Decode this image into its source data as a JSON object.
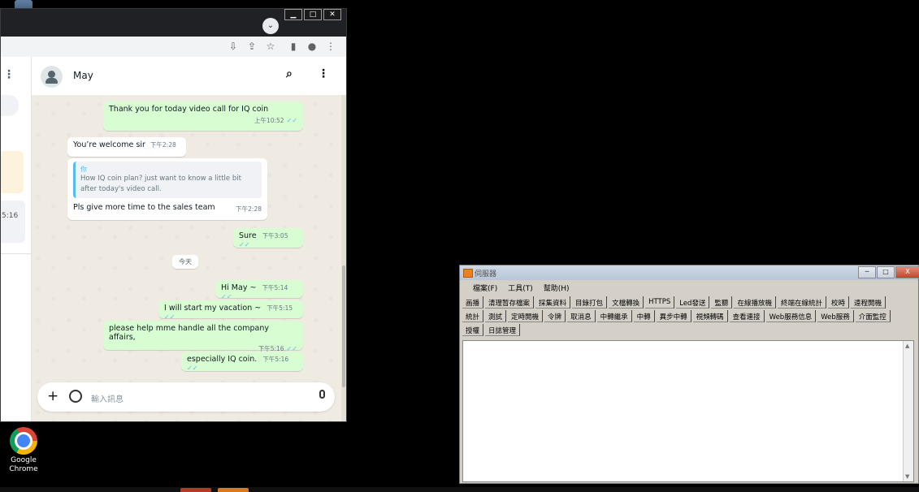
{
  "desktop": {
    "top_icon_label": "",
    "chrome_icon_label_line1": "Google",
    "chrome_icon_label_line2": "Chrome"
  },
  "chrome_window": {
    "caption_buttons": [
      "▁",
      "□",
      "✕"
    ],
    "tab_search_icon": "chevron-down-icon",
    "toolbar_icons": [
      "install-icon",
      "share-icon",
      "star-icon",
      "sidepanel-icon",
      "profile-icon",
      "menu-icon"
    ]
  },
  "whatsapp": {
    "sidebar_time": "5:16",
    "contact_name": "May",
    "messages": [
      {
        "dir": "out",
        "text": "Thank you for today video call for IQ coin",
        "time": "上午10:52",
        "ticks": "✓✓"
      },
      {
        "dir": "in",
        "text": "You’re welcome sir",
        "time": "下午2:28"
      },
      {
        "dir": "in",
        "reply_author": "你",
        "reply_text": "How IQ coin plan? just want to know a little bit after today's video call.",
        "text": "Pls give more time to the sales team",
        "time": "下午2:28"
      },
      {
        "dir": "out",
        "text": "Sure",
        "time": "下午3:05",
        "ticks": "✓✓"
      },
      {
        "dir": "out",
        "text": "Hi May ~",
        "time": "下午5:14",
        "ticks": "✓✓"
      },
      {
        "dir": "out",
        "text": "I will start my vacation ~",
        "time": "下午5:15",
        "ticks": "✓✓"
      },
      {
        "dir": "out",
        "text": "please help mme handle all the company affairs,",
        "time": "下午5:16",
        "ticks": "✓✓"
      },
      {
        "dir": "out",
        "text": "especially IQ coin.",
        "time": "下午5:16",
        "ticks": "✓✓"
      }
    ],
    "date_divider": "今天",
    "composer_placeholder": "輸入訊息"
  },
  "tool_window": {
    "title": "伺服器",
    "caption_buttons": [
      "─",
      "□",
      "X"
    ],
    "menu": [
      "檔案(F)",
      "工具(T)",
      "幫助(H)"
    ],
    "button_rows": [
      [
        "画播",
        "清理暂存檔案",
        "採集資料",
        "目錄打包",
        "文檔轉換",
        "HTTPS",
        "Led發送",
        "監聽",
        "在線播放機",
        "終端在線統計",
        "校時",
        "遠程開機"
      ],
      [
        "統計",
        "測試",
        "定時開機",
        "令牌",
        "取消息",
        "中轉繼承",
        "中轉",
        "異步中轉",
        "視頻轉碼",
        "查看連接",
        "Web服務信息",
        "Web服務",
        "介面監控"
      ],
      [
        "授權",
        "日誌管理"
      ]
    ]
  }
}
